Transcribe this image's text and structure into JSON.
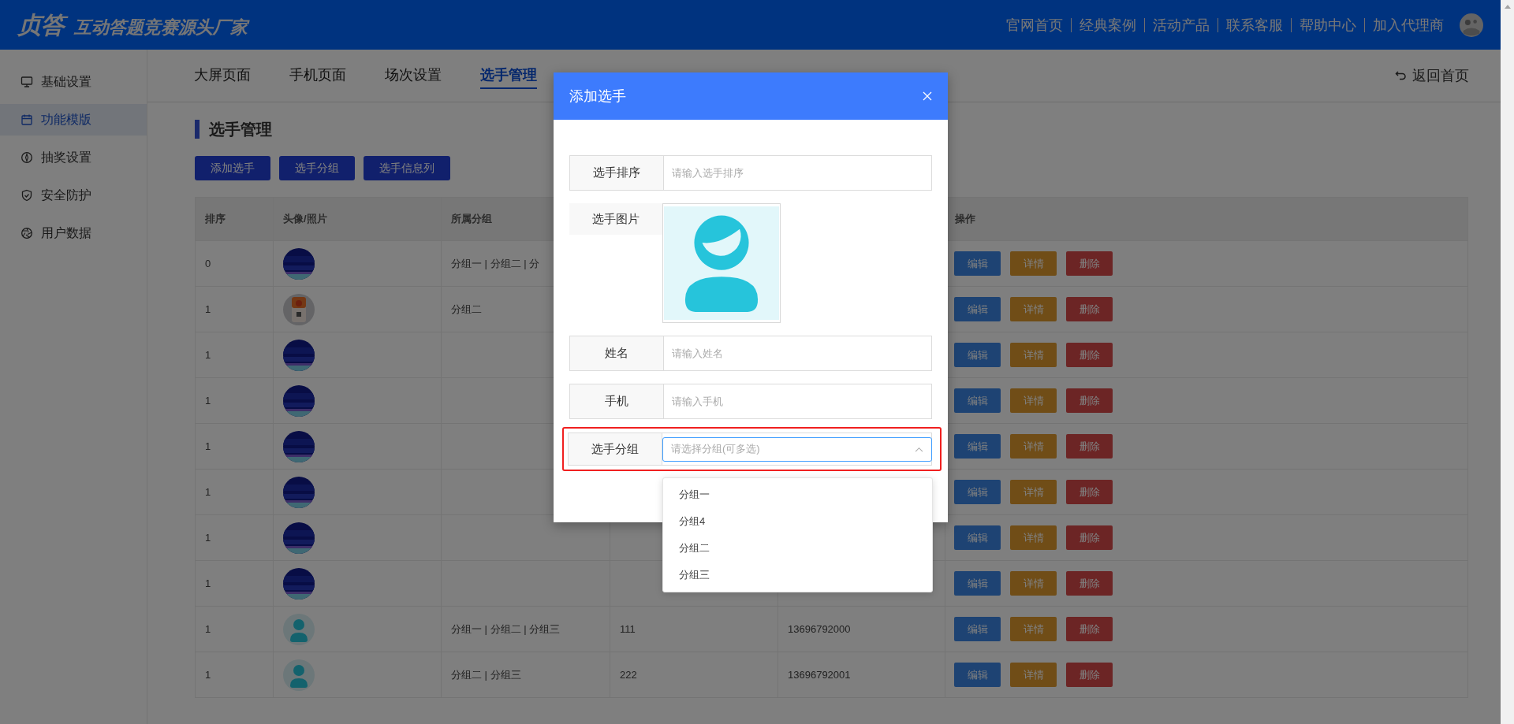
{
  "header": {
    "logo": "贞答",
    "slogan": "互动答题竞赛源头厂家",
    "nav": [
      "官网首页",
      "经典案例",
      "活动产品",
      "联系客服",
      "帮助中心",
      "加入代理商"
    ]
  },
  "sidebar": {
    "items": [
      {
        "label": "基础设置",
        "selected": false
      },
      {
        "label": "功能模版",
        "selected": true
      },
      {
        "label": "抽奖设置",
        "selected": false
      },
      {
        "label": "安全防护",
        "selected": false
      },
      {
        "label": "用户数据",
        "selected": false
      }
    ]
  },
  "tabs": [
    {
      "label": "大屏页面",
      "selected": false
    },
    {
      "label": "手机页面",
      "selected": false
    },
    {
      "label": "场次设置",
      "selected": false
    },
    {
      "label": "选手管理",
      "selected": true
    }
  ],
  "back_link": "返回首页",
  "section_title": "选手管理",
  "toolbar": [
    "添加选手",
    "选手分组",
    "选手信息列"
  ],
  "table": {
    "columns": [
      "排序",
      "头像/照片",
      "所属分组",
      "操作"
    ],
    "rows": [
      {
        "order": "0",
        "kind": "picture",
        "groups": "分组一 | 分组二 | 分",
        "actions": [
          "编辑",
          "详情",
          "删除"
        ]
      },
      {
        "order": "1",
        "kind": "picture",
        "groups": "分组二",
        "actions": [
          "编辑",
          "详情",
          "删除"
        ]
      },
      {
        "order": "1",
        "kind": "picture",
        "actions": [
          "编辑",
          "详情",
          "删除"
        ]
      },
      {
        "order": "1",
        "kind": "picture",
        "actions": [
          "编辑",
          "详情",
          "删除"
        ]
      },
      {
        "order": "1",
        "kind": "picture",
        "actions": [
          "编辑",
          "详情",
          "删除"
        ]
      },
      {
        "order": "1",
        "kind": "picture",
        "actions": [
          "编辑",
          "详情",
          "删除"
        ]
      },
      {
        "order": "1",
        "kind": "picture",
        "actions": [
          "编辑",
          "详情",
          "删除"
        ]
      },
      {
        "order": "1",
        "kind": "picture",
        "actions": [
          "编辑",
          "详情",
          "删除"
        ]
      },
      {
        "order": "1",
        "kind": "default_avatar",
        "groups": "分组一 | 分组二 | 分组三",
        "column_4": "111",
        "column_5": "13696792000",
        "actions": [
          "编辑",
          "详情",
          "删除"
        ]
      },
      {
        "order": "1",
        "kind": "default_avatar",
        "groups": "分组二 | 分组三",
        "column_4": "222",
        "column_5": "13696792001",
        "actions": [
          "编辑",
          "详情",
          "删除"
        ]
      }
    ]
  },
  "dialog": {
    "title": "添加选手",
    "fields": [
      {
        "kind": "input",
        "label": "选手排序",
        "placeholder": "请输入选手排序"
      },
      {
        "label": "选手图片"
      },
      {
        "kind": "input",
        "label": "姓名",
        "placeholder": "请输入姓名"
      },
      {
        "kind": "input",
        "label": "手机",
        "placeholder": "请输入手机"
      },
      {
        "kind": "select",
        "label": "选手分组",
        "placeholder": "请选择分组(可多选)",
        "highlighted": true,
        "expanded": true,
        "options": [
          "分组一",
          "分组4",
          "分组二",
          "分组三"
        ]
      }
    ]
  }
}
